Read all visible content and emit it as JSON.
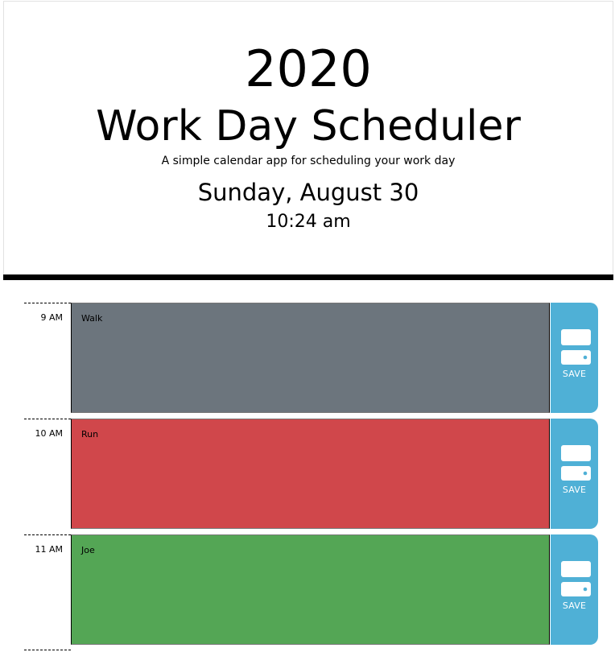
{
  "header": {
    "year": "2020",
    "title": "Work Day Scheduler",
    "subtitle": "A simple calendar app for scheduling your work day",
    "date": "Sunday, August 30",
    "time": "10:24 am"
  },
  "colors": {
    "past": "#6c757d",
    "present": "#d0474b",
    "future": "#54a655",
    "save": "#4fb0d6"
  },
  "rows": [
    {
      "hour": "9 AM",
      "text": "Walk",
      "state": "past",
      "save_label": "SAVE",
      "icon": "save-icon"
    },
    {
      "hour": "10 AM",
      "text": "Run",
      "state": "present",
      "save_label": "SAVE",
      "icon": "save-icon"
    },
    {
      "hour": "11 AM",
      "text": "Joe",
      "state": "future",
      "save_label": "SAVE",
      "icon": "save-icon"
    }
  ]
}
